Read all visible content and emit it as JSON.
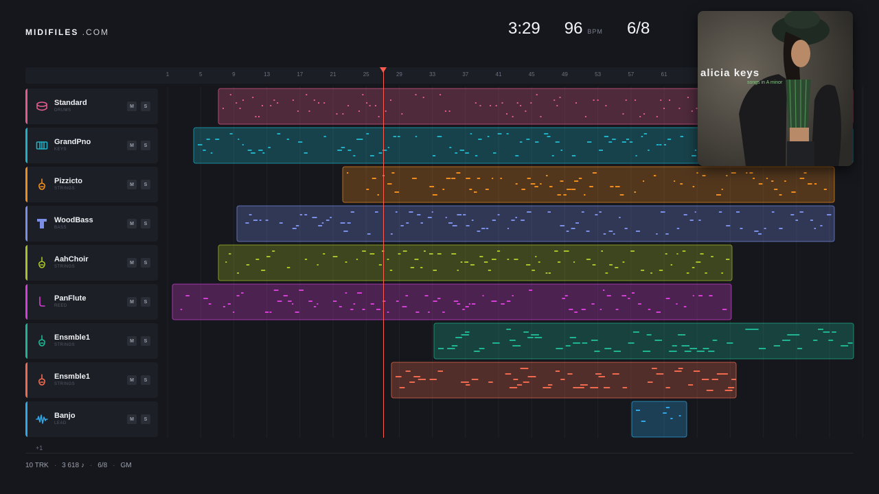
{
  "brand": {
    "bold": "MIDIFILES",
    "light": ".COM"
  },
  "stats": {
    "time": "3:29",
    "bpm": "96",
    "bpm_label": "BPM",
    "signature": "6/8"
  },
  "album": {
    "artist": "alicia keys",
    "title": "songs in A minor"
  },
  "ruler": [
    "1",
    "5",
    "9",
    "13",
    "17",
    "21",
    "25",
    "29",
    "33",
    "37",
    "41",
    "45",
    "49",
    "53",
    "57",
    "61"
  ],
  "playhead_bar": 27,
  "tracks": [
    {
      "name": "Standard",
      "category": "DRUMS",
      "color": "#e35d8c",
      "icon": "drum-icon",
      "mute": "M",
      "solo": "S"
    },
    {
      "name": "GrandPno",
      "category": "KEYS",
      "color": "#1fb2c7",
      "icon": "keyboard-icon",
      "mute": "M",
      "solo": "S"
    },
    {
      "name": "Pizzicto",
      "category": "STRINGS",
      "color": "#ef8d1f",
      "icon": "violin-icon",
      "mute": "M",
      "solo": "S"
    },
    {
      "name": "WoodBass",
      "category": "BASS",
      "color": "#7b8fe8",
      "icon": "bass-icon",
      "mute": "M",
      "solo": "S"
    },
    {
      "name": "AahChoir",
      "category": "STRINGS",
      "color": "#a9c22a",
      "icon": "violin-icon",
      "mute": "M",
      "solo": "S"
    },
    {
      "name": "PanFlute",
      "category": "REED",
      "color": "#d63fd6",
      "icon": "flute-icon",
      "mute": "M",
      "solo": "S"
    },
    {
      "name": "Ensmble1",
      "category": "STRINGS",
      "color": "#1fb592",
      "icon": "violin-icon",
      "mute": "M",
      "solo": "S"
    },
    {
      "name": "Ensmble1",
      "category": "STRINGS",
      "color": "#f06a4f",
      "icon": "violin-icon",
      "mute": "M",
      "solo": "S"
    },
    {
      "name": "Banjo",
      "category": "LEAD",
      "color": "#2fa8e8",
      "icon": "waveform-icon",
      "mute": "M",
      "solo": "S"
    }
  ],
  "more_tracks": "+1",
  "footer": {
    "tracks": "10 TRK",
    "notes": "3 618 ♪",
    "signature": "6/8",
    "standard": "GM"
  }
}
